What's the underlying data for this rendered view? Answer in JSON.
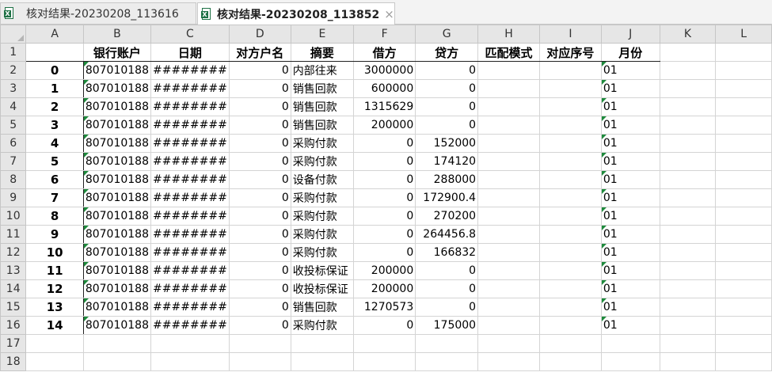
{
  "tabs": [
    {
      "label": "核对结果-20230208_113616",
      "active": false
    },
    {
      "label": "核对结果-20230208_113852",
      "active": true
    }
  ],
  "columns": [
    "A",
    "B",
    "C",
    "D",
    "E",
    "F",
    "G",
    "H",
    "I",
    "J",
    "K",
    "L"
  ],
  "header": [
    "",
    "银行账户",
    "日期",
    "对方户名",
    "摘要",
    "借方",
    "贷方",
    "匹配模式",
    "对应序号",
    "月份"
  ],
  "rows": [
    {
      "idx": "0",
      "account": "807010188",
      "date": "########",
      "party": "0",
      "summary": "内部往来",
      "debit": "3000000",
      "credit": "0",
      "month": "01"
    },
    {
      "idx": "1",
      "account": "807010188",
      "date": "########",
      "party": "0",
      "summary": "销售回款",
      "debit": "600000",
      "credit": "0",
      "month": "01"
    },
    {
      "idx": "2",
      "account": "807010188",
      "date": "########",
      "party": "0",
      "summary": "销售回款",
      "debit": "1315629",
      "credit": "0",
      "month": "01"
    },
    {
      "idx": "3",
      "account": "807010188",
      "date": "########",
      "party": "0",
      "summary": "销售回款",
      "debit": "200000",
      "credit": "0",
      "month": "01"
    },
    {
      "idx": "4",
      "account": "807010188",
      "date": "########",
      "party": "0",
      "summary": "采购付款",
      "debit": "0",
      "credit": "152000",
      "month": "01"
    },
    {
      "idx": "5",
      "account": "807010188",
      "date": "########",
      "party": "0",
      "summary": "采购付款",
      "debit": "0",
      "credit": "174120",
      "month": "01"
    },
    {
      "idx": "6",
      "account": "807010188",
      "date": "########",
      "party": "0",
      "summary": "设备付款",
      "debit": "0",
      "credit": "288000",
      "month": "01"
    },
    {
      "idx": "7",
      "account": "807010188",
      "date": "########",
      "party": "0",
      "summary": "采购付款",
      "debit": "0",
      "credit": "172900.4",
      "month": "01"
    },
    {
      "idx": "8",
      "account": "807010188",
      "date": "########",
      "party": "0",
      "summary": "采购付款",
      "debit": "0",
      "credit": "270200",
      "month": "01"
    },
    {
      "idx": "9",
      "account": "807010188",
      "date": "########",
      "party": "0",
      "summary": "采购付款",
      "debit": "0",
      "credit": "264456.8",
      "month": "01"
    },
    {
      "idx": "10",
      "account": "807010188",
      "date": "########",
      "party": "0",
      "summary": "采购付款",
      "debit": "0",
      "credit": "166832",
      "month": "01"
    },
    {
      "idx": "11",
      "account": "807010188",
      "date": "########",
      "party": "0",
      "summary": "收投标保证",
      "debit": "200000",
      "credit": "0",
      "month": "01"
    },
    {
      "idx": "12",
      "account": "807010188",
      "date": "########",
      "party": "0",
      "summary": "收投标保证",
      "debit": "200000",
      "credit": "0",
      "month": "01"
    },
    {
      "idx": "13",
      "account": "807010188",
      "date": "########",
      "party": "0",
      "summary": "销售回款",
      "debit": "1270573",
      "credit": "0",
      "month": "01"
    },
    {
      "idx": "14",
      "account": "807010188",
      "date": "########",
      "party": "0",
      "summary": "采购付款",
      "debit": "0",
      "credit": "175000",
      "month": "01"
    }
  ],
  "row_numbers": [
    "1",
    "2",
    "3",
    "4",
    "5",
    "6",
    "7",
    "8",
    "9",
    "10",
    "11",
    "12",
    "13",
    "14",
    "15",
    "16",
    "17",
    "18"
  ],
  "colors": {
    "accent_green": "#1e8a3c",
    "excel_green": "#1e7145"
  }
}
